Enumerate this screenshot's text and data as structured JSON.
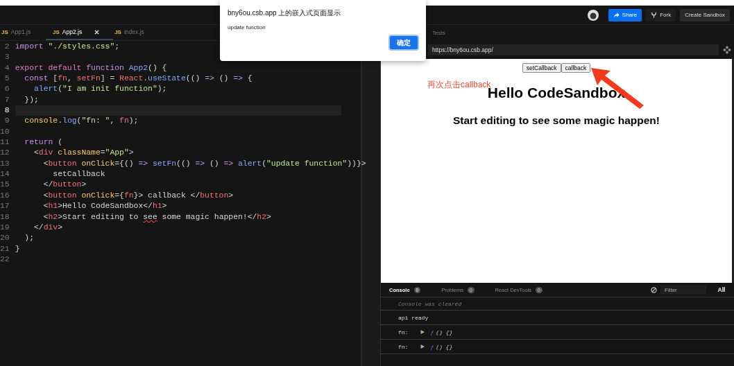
{
  "header": {
    "buttons": [
      {
        "label": "Share",
        "kind": "share"
      },
      {
        "label": "Fork",
        "kind": "fork"
      },
      {
        "label": "Create Sandbox",
        "kind": "plain"
      }
    ]
  },
  "editor": {
    "tabs": [
      {
        "badge": "JS",
        "label": "App1.js",
        "selected": false
      },
      {
        "badge": "JS",
        "label": "App2.js",
        "selected": true
      },
      {
        "badge": "JS",
        "label": "index.js",
        "selected": false
      }
    ],
    "lines": [
      {
        "number": "2",
        "current": false,
        "tokens": [
          {
            "kind": "kw",
            "text": "import"
          },
          {
            "kind": "str",
            "text": " \"./styles.css\""
          },
          {
            "kind": "p",
            "text": ";"
          }
        ]
      },
      {
        "number": "3",
        "current": false
      },
      {
        "number": "4",
        "current": false,
        "tokens": [
          {
            "kind": "kw2",
            "text": "export default"
          },
          {
            "kind": "kw",
            "text": " function"
          },
          {
            "kind": "fn",
            "text": " App2"
          },
          {
            "kind": "p",
            "text": "() {"
          }
        ]
      },
      {
        "number": "5",
        "current": false,
        "tokens": [
          {
            "kind": "kw",
            "text": "  const"
          },
          {
            "kind": "p",
            "text": " ["
          },
          {
            "kind": "var",
            "text": "fn"
          },
          {
            "kind": "p",
            "text": ", "
          },
          {
            "kind": "var",
            "text": "setFn"
          },
          {
            "kind": "p",
            "text": "] = "
          },
          {
            "kind": "var",
            "text": "React"
          },
          {
            "kind": "p",
            "text": "."
          },
          {
            "kind": "fn",
            "text": "useState"
          },
          {
            "kind": "p",
            "text": "(() "
          },
          {
            "kind": "kw",
            "text": "=>"
          },
          {
            "kind": "p",
            "text": " () "
          },
          {
            "kind": "kw",
            "text": "=>"
          },
          {
            "kind": "p",
            "text": " {"
          }
        ]
      },
      {
        "number": "6",
        "current": false,
        "tokens": [
          {
            "kind": "fn",
            "text": "    alert"
          },
          {
            "kind": "p",
            "text": "("
          },
          {
            "kind": "str",
            "text": "\"I am init function\""
          },
          {
            "kind": "p",
            "text": ");"
          }
        ]
      },
      {
        "number": "7",
        "current": false,
        "tokens": [
          {
            "kind": "p",
            "text": "  });"
          }
        ]
      },
      {
        "number": "8",
        "current": true
      },
      {
        "number": "9",
        "current": false,
        "tokens": [
          {
            "kind": "obj",
            "text": "  console"
          },
          {
            "kind": "p",
            "text": "."
          },
          {
            "kind": "fn",
            "text": "log"
          },
          {
            "kind": "p",
            "text": "("
          },
          {
            "kind": "str",
            "text": "\"fn: \""
          },
          {
            "kind": "p",
            "text": ", "
          },
          {
            "kind": "var",
            "text": "fn"
          },
          {
            "kind": "p",
            "text": ");"
          }
        ]
      },
      {
        "number": "10",
        "current": false
      },
      {
        "number": "11",
        "current": false,
        "tokens": [
          {
            "kind": "kw",
            "text": "  return"
          },
          {
            "kind": "p",
            "text": " ("
          }
        ]
      },
      {
        "number": "12",
        "current": false,
        "tokens": [
          {
            "kind": "p",
            "text": "    <"
          },
          {
            "kind": "tag",
            "text": "div"
          },
          {
            "kind": "attr",
            "text": " className"
          },
          {
            "kind": "p",
            "text": "="
          },
          {
            "kind": "str",
            "text": "\"App\""
          },
          {
            "kind": "p",
            "text": ">"
          }
        ]
      },
      {
        "number": "13",
        "current": false,
        "tokens": [
          {
            "kind": "p",
            "text": "      <"
          },
          {
            "kind": "tag",
            "text": "button"
          },
          {
            "kind": "attr",
            "text": " onClick"
          },
          {
            "kind": "p",
            "text": "={() "
          },
          {
            "kind": "kw",
            "text": "=>"
          },
          {
            "kind": "fn",
            "text": " setFn"
          },
          {
            "kind": "p",
            "text": "(() "
          },
          {
            "kind": "kw",
            "text": "=>"
          },
          {
            "kind": "p",
            "text": " () "
          },
          {
            "kind": "kw",
            "text": "=>"
          },
          {
            "kind": "fn",
            "text": " alert"
          },
          {
            "kind": "p",
            "text": "("
          },
          {
            "kind": "str",
            "text": "\"update function\""
          },
          {
            "kind": "p",
            "text": "))}>"
          }
        ]
      },
      {
        "number": "14",
        "current": false,
        "tokens": [
          {
            "kind": "p",
            "text": "        setCallback"
          }
        ]
      },
      {
        "number": "15",
        "current": false,
        "tokens": [
          {
            "kind": "p",
            "text": "      </"
          },
          {
            "kind": "tag",
            "text": "button"
          },
          {
            "kind": "p",
            "text": ">"
          }
        ]
      },
      {
        "number": "16",
        "current": false,
        "tokens": [
          {
            "kind": "p",
            "text": "      <"
          },
          {
            "kind": "tag",
            "text": "button"
          },
          {
            "kind": "attr",
            "text": " onClick"
          },
          {
            "kind": "p",
            "text": "={"
          },
          {
            "kind": "var",
            "text": "fn"
          },
          {
            "kind": "p",
            "text": "}> callback </"
          },
          {
            "kind": "tag",
            "text": "button"
          },
          {
            "kind": "p",
            "text": ">"
          }
        ]
      },
      {
        "number": "17",
        "current": false,
        "tokens": [
          {
            "kind": "p",
            "text": "      <"
          },
          {
            "kind": "tag",
            "text": "h1"
          },
          {
            "kind": "p",
            "text": ">Hello CodeSandbox</"
          },
          {
            "kind": "tag",
            "text": "h1"
          },
          {
            "kind": "p",
            "text": ">"
          }
        ]
      },
      {
        "number": "18",
        "current": false,
        "tokens": [
          {
            "kind": "p",
            "text": "      <"
          },
          {
            "kind": "tag",
            "text": "h2"
          },
          {
            "kind": "p",
            "text": ">Start editing to "
          },
          {
            "kind": "typo",
            "text": "see"
          },
          {
            "kind": "p",
            "text": " some magic happen!</"
          },
          {
            "kind": "tag",
            "text": "h2"
          },
          {
            "kind": "p",
            "text": ">"
          }
        ]
      },
      {
        "number": "19",
        "current": false,
        "tokens": [
          {
            "kind": "p",
            "text": "    </"
          },
          {
            "kind": "tag",
            "text": "div"
          },
          {
            "kind": "p",
            "text": ">"
          }
        ]
      },
      {
        "number": "20",
        "current": false,
        "tokens": [
          {
            "kind": "p",
            "text": "  );"
          }
        ]
      },
      {
        "number": "21",
        "current": false,
        "tokens": [
          {
            "kind": "p",
            "text": "}"
          }
        ]
      },
      {
        "number": "22",
        "current": false
      }
    ]
  },
  "preview": {
    "tab": "Tests",
    "url": "https://bny6ou.csb.app/",
    "buttons": [
      "setCallback",
      "callback"
    ],
    "heading": "Hello CodeSandbox",
    "subheading": "Start editing to see some magic happen!",
    "annotation": "再次点击callback"
  },
  "console": {
    "tabs": [
      {
        "label": "Console",
        "count": "0",
        "selected": true
      },
      {
        "label": "Problems",
        "count": "0",
        "selected": false
      },
      {
        "label": "React DevTools",
        "count": "0",
        "selected": false
      }
    ],
    "filter": {
      "placeholder": "Filter"
    },
    "level": "All",
    "entries": [
      {
        "kind": "info",
        "text": "Console was cleared"
      },
      {
        "kind": "log",
        "text": "api ready"
      },
      {
        "kind": "function",
        "label": "fn:",
        "expanded": false,
        "type": "ƒ",
        "value": "() {}"
      },
      {
        "kind": "function",
        "label": "fn:",
        "expanded": false,
        "type": "ƒ",
        "value": "() {}"
      }
    ]
  },
  "dialog": {
    "title": "bny6ou.csb.app 上的嵌入式页面显示",
    "message": "update function",
    "button": "确定"
  }
}
